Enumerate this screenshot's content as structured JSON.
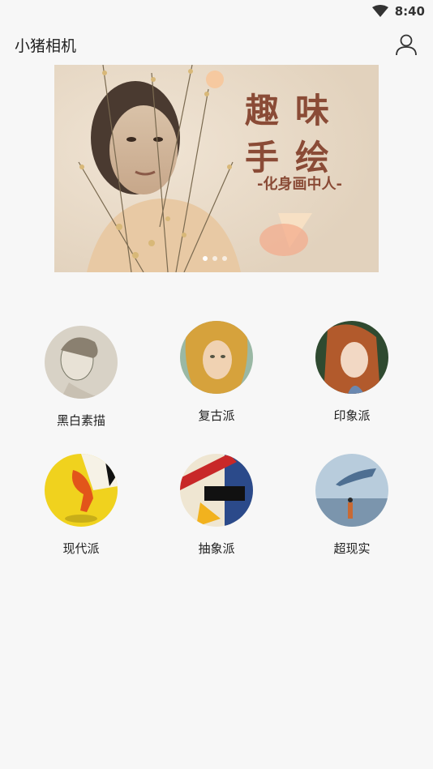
{
  "status": {
    "time": "8:40"
  },
  "header": {
    "title": "小猪相机"
  },
  "banner": {
    "title": "趣味手绘",
    "subtitle": "-化身画中人-",
    "page_count": 3,
    "active_page": 1
  },
  "styles": [
    {
      "label": "黑白素描",
      "icon": "sketch-thumbnail"
    },
    {
      "label": "复古派",
      "icon": "renaissance-thumbnail"
    },
    {
      "label": "印象派",
      "icon": "impressionist-thumbnail"
    },
    {
      "label": "现代派",
      "icon": "modern-thumbnail"
    },
    {
      "label": "抽象派",
      "icon": "abstract-thumbnail"
    },
    {
      "label": "超现实",
      "icon": "surreal-thumbnail"
    }
  ]
}
